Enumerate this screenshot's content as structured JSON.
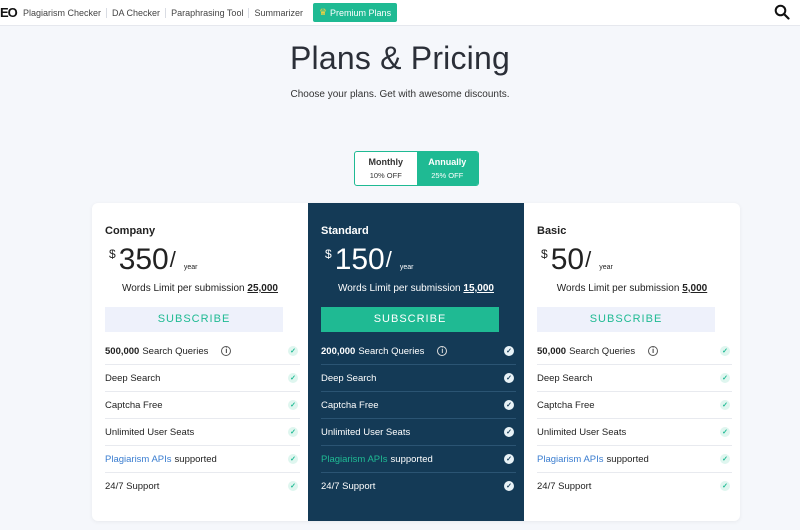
{
  "nav": {
    "logo": "EO",
    "links": [
      "Plagiarism Checker",
      "DA Checker",
      "Paraphrasing Tool",
      "Summarizer"
    ],
    "premium": "Premium Plans"
  },
  "header": {
    "title": "Plans & Pricing",
    "subtitle": "Choose your plans. Get with awesome discounts."
  },
  "toggle": {
    "monthly": {
      "label": "Monthly",
      "discount": "10% OFF"
    },
    "annually": {
      "label": "Annually",
      "discount": "25% OFF"
    }
  },
  "plans": [
    {
      "name": "Company",
      "currency": "$",
      "price": "350",
      "per": "/",
      "period": "year",
      "limit_text": "Words Limit per submission",
      "limit_value": "25,000",
      "cta": "SUBSCRIBE",
      "features": {
        "queries_count": "500,000",
        "queries_label": "Search Queries",
        "deep": "Deep Search",
        "captcha": "Captcha Free",
        "seats": "Unlimited User Seats",
        "api_link": "Plagiarism APIs",
        "api_rest": "supported",
        "support": "24/7 Support"
      }
    },
    {
      "name": "Standard",
      "currency": "$",
      "price": "150",
      "per": "/",
      "period": "year",
      "limit_text": "Words Limit per submission",
      "limit_value": "15,000",
      "cta": "SUBSCRIBE",
      "features": {
        "queries_count": "200,000",
        "queries_label": "Search Queries",
        "deep": "Deep Search",
        "captcha": "Captcha Free",
        "seats": "Unlimited User Seats",
        "api_link": "Plagiarism APIs",
        "api_rest": "supported",
        "support": "24/7 Support"
      }
    },
    {
      "name": "Basic",
      "currency": "$",
      "price": "50",
      "per": "/",
      "period": "year",
      "limit_text": "Words Limit per submission",
      "limit_value": "5,000",
      "cta": "SUBSCRIBE",
      "features": {
        "queries_count": "50,000",
        "queries_label": "Search Queries",
        "deep": "Deep Search",
        "captcha": "Captcha Free",
        "seats": "Unlimited User Seats",
        "api_link": "Plagiarism APIs",
        "api_rest": "supported",
        "support": "24/7 Support"
      }
    }
  ],
  "icons": {
    "search": "search-icon",
    "info": "info-icon",
    "check": "check-icon",
    "crown": "crown-icon"
  },
  "colors": {
    "accent": "#1fba93",
    "featured_bg": "#143a56",
    "link": "#3a7dd0"
  }
}
